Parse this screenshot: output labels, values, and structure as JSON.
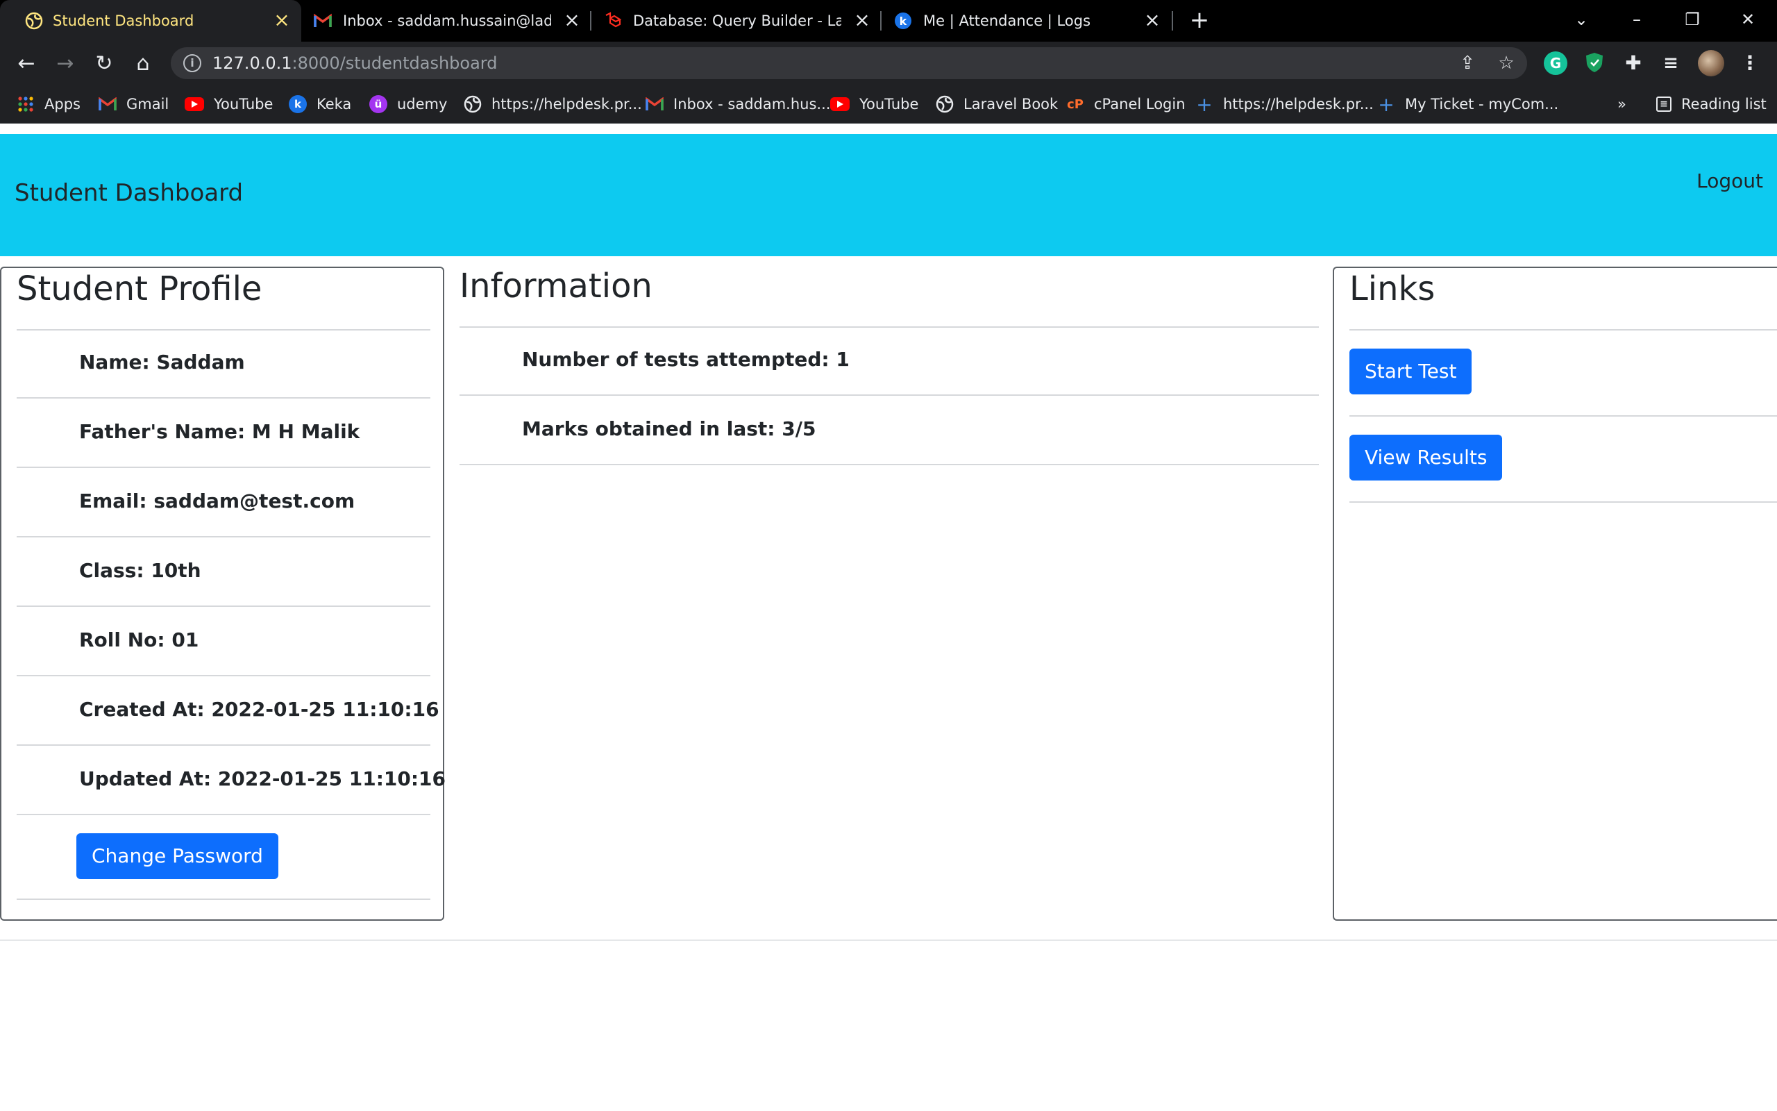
{
  "browser": {
    "tabs": [
      {
        "title": "Student Dashboard",
        "icon": "globe-icon",
        "active": true
      },
      {
        "title": "Inbox - saddam.hussain@ladybird",
        "icon": "gmail-icon"
      },
      {
        "title": "Database: Query Builder - Laravel",
        "icon": "laravel-icon"
      },
      {
        "title": "Me | Attendance | Logs",
        "icon": "keka-icon"
      }
    ],
    "new_tab_symbol": "+",
    "url_host": "127.0.0.1",
    "url_rest": ":8000/studentdashboard",
    "bookmarks": [
      {
        "label": "Apps",
        "icon": "apps-grid-icon"
      },
      {
        "label": "Gmail",
        "icon": "gmail-icon"
      },
      {
        "label": "YouTube",
        "icon": "youtube-icon"
      },
      {
        "label": "Keka",
        "icon": "keka-icon"
      },
      {
        "label": "udemy",
        "icon": "udemy-icon"
      },
      {
        "label": "https://helpdesk.pr...",
        "icon": "globe-icon"
      },
      {
        "label": "Inbox - saddam.hus...",
        "icon": "gmail-icon"
      },
      {
        "label": "YouTube",
        "icon": "youtube-icon"
      },
      {
        "label": "Laravel Book",
        "icon": "globe-icon"
      },
      {
        "label": "cPanel Login",
        "icon": "cpanel-icon"
      },
      {
        "label": "https://helpdesk.pr...",
        "icon": "plus-icon"
      },
      {
        "label": "My Ticket - myCom...",
        "icon": "plus-icon"
      }
    ],
    "more_bookmarks": "»",
    "reading_list": "Reading list"
  },
  "colors": {
    "navbar_bg": "#0dcaf0",
    "primary_button": "#0d6efd",
    "active_tab_text": "#ffe680"
  },
  "navbar": {
    "brand": "Student Dashboard",
    "logout": "Logout"
  },
  "profile": {
    "heading": "Student Profile",
    "fields": [
      "Name: Saddam",
      "Father's Name: M H Malik",
      "Email: saddam@test.com",
      "Class: 10th",
      "Roll No: 01",
      "Created At: 2022-01-25 11:10:16",
      "Updated At: 2022-01-25 11:10:16"
    ],
    "change_password": "Change Password"
  },
  "information": {
    "heading": "Information",
    "items": [
      "Number of tests attempted: 1",
      "Marks obtained in last: 3/5"
    ]
  },
  "links": {
    "heading": "Links",
    "start_test": "Start Test",
    "view_results": "View Results"
  }
}
